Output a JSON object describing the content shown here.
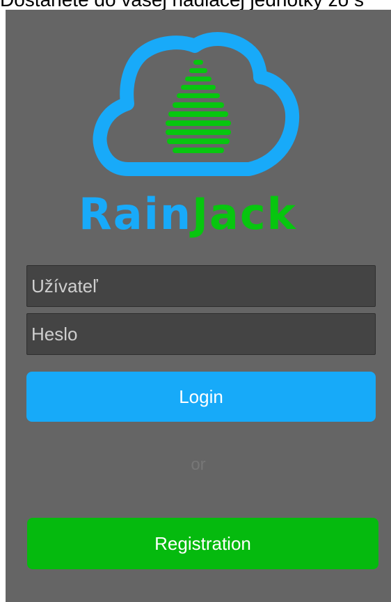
{
  "header": {
    "partial_text": "Dostanete do vašej riadiacej jednotky zo s"
  },
  "brand": {
    "name_part1": "Rain",
    "name_part2": "Jack",
    "color_primary": "#18aaf9",
    "color_secondary": "#07c60f"
  },
  "login_form": {
    "username_placeholder": "Užívateľ",
    "password_placeholder": "Heslo",
    "login_label": "Login",
    "or_label": "or",
    "register_label": "Registration"
  },
  "colors": {
    "panel_bg": "#656565",
    "input_bg": "#444444",
    "login_button": "#17aaf9",
    "register_button": "#05ba0e"
  }
}
